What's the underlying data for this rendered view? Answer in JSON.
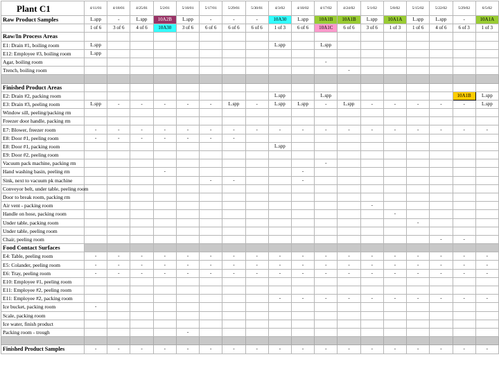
{
  "title": "Plant C1",
  "dates": [
    "4/11/01",
    "4/18/01",
    "4/25/01",
    "5/2/01",
    "5/10/01",
    "5/17/01",
    "5/29/01",
    "5/30/01",
    "4/3/02",
    "4/10/02",
    "4/17/02",
    "4/24/02",
    "5/1/02",
    "5/8/02",
    "5/15/02",
    "5/22/02",
    "5/29/02",
    "6/5/02"
  ],
  "colors": {
    "purple": "#993366",
    "cyan": "#33ffff",
    "green": "#99cc33",
    "pink": "#ff99cc",
    "orange": "#ffcc00",
    "gray": "#c8c8c8"
  },
  "rows": [
    {
      "type": "raw",
      "label": "Raw Product Samples",
      "cells": [
        {
          "v": "L.spp"
        },
        {
          "v": "-"
        },
        {
          "v": "L.spp"
        },
        {
          "v": "10A2B",
          "c": "purple"
        },
        {
          "v": "L.spp"
        },
        {
          "v": "-"
        },
        {
          "v": "-"
        },
        {
          "v": "-"
        },
        {
          "v": "10A30",
          "c": "cyan"
        },
        {
          "v": "L.spp"
        },
        {
          "v": "10A1B",
          "c": "green"
        },
        {
          "v": "10A1B",
          "c": "green"
        },
        {
          "v": "L.spp"
        },
        {
          "v": "10A1A",
          "c": "green"
        },
        {
          "v": "L.spp"
        },
        {
          "v": "L.spp"
        },
        {
          "v": "-"
        },
        {
          "v": "10A1A",
          "c": "green"
        }
      ]
    },
    {
      "type": "data",
      "label": "",
      "cells": [
        {
          "v": "1 of 6"
        },
        {
          "v": "3 of 6"
        },
        {
          "v": "4 of 6"
        },
        {
          "v": "10A30",
          "c": "cyan"
        },
        {
          "v": "3 of 6"
        },
        {
          "v": "6 of 6"
        },
        {
          "v": "6 of 6"
        },
        {
          "v": "6 of 6"
        },
        {
          "v": "1 of 3"
        },
        {
          "v": "6 of 6"
        },
        {
          "v": "10A1C",
          "c": "pink"
        },
        {
          "v": "6 of 6"
        },
        {
          "v": "3 of 6"
        },
        {
          "v": "1 of 3"
        },
        {
          "v": "1 of 6"
        },
        {
          "v": "4 of 6"
        },
        {
          "v": "6 of 3"
        },
        {
          "v": "1 of 3"
        }
      ]
    },
    {
      "type": "section",
      "label": "Raw/In Process Areas"
    },
    {
      "type": "data",
      "label": "E1:  Drain #1, boiling room",
      "cells": [
        {
          "v": "L.spp"
        },
        {},
        {},
        {},
        {},
        {},
        {},
        {},
        {
          "v": "L.spp"
        },
        {},
        {
          "v": "L.spp"
        },
        {},
        {},
        {},
        {},
        {},
        {},
        {}
      ]
    },
    {
      "type": "data",
      "label": "E12:  Employee #3, boiling room",
      "cells": [
        {
          "v": "L.spp"
        },
        {},
        {},
        {},
        {},
        {},
        {},
        {},
        {},
        {},
        {},
        {},
        {},
        {},
        {},
        {},
        {},
        {}
      ]
    },
    {
      "type": "data",
      "label": "Agar, boiling room",
      "cells": [
        {},
        {},
        {},
        {},
        {},
        {},
        {},
        {},
        {},
        {},
        {
          "v": "-"
        },
        {},
        {},
        {},
        {},
        {},
        {},
        {}
      ]
    },
    {
      "type": "data",
      "label": "Trench, boiling room",
      "cells": [
        {},
        {},
        {},
        {},
        {},
        {},
        {},
        {},
        {},
        {},
        {},
        {
          "v": "-"
        },
        {},
        {},
        {},
        {},
        {},
        {}
      ]
    },
    {
      "type": "gray",
      "label": ""
    },
    {
      "type": "section",
      "label": "Finished Product Areas"
    },
    {
      "type": "data",
      "label": "E2:  Drain #2, packing room",
      "cells": [
        {},
        {},
        {},
        {},
        {},
        {},
        {},
        {},
        {
          "v": "L.spp"
        },
        {},
        {
          "v": "L.spp"
        },
        {},
        {},
        {},
        {},
        {},
        {
          "v": "10A1B",
          "c": "orange"
        },
        {
          "v": "L.spp"
        }
      ]
    },
    {
      "type": "data",
      "label": "E3:  Drain #3, peeling room",
      "cells": [
        {
          "v": "L.spp"
        },
        {
          "v": "-"
        },
        {
          "v": "-"
        },
        {
          "v": "-"
        },
        {
          "v": "-"
        },
        {
          "v": "-"
        },
        {
          "v": "L.spp"
        },
        {
          "v": "-"
        },
        {
          "v": "L.spp"
        },
        {
          "v": "L.spp"
        },
        {
          "v": "-"
        },
        {
          "v": "L.spp"
        },
        {
          "v": "-"
        },
        {
          "v": "-"
        },
        {
          "v": "-"
        },
        {
          "v": "-"
        },
        {
          "v": "-"
        },
        {
          "v": "L.spp"
        }
      ]
    },
    {
      "type": "data",
      "label": "Window sill, peeling/packing rm",
      "cells": [
        {},
        {},
        {},
        {},
        {},
        {},
        {},
        {},
        {},
        {},
        {},
        {},
        {},
        {},
        {},
        {},
        {},
        {}
      ]
    },
    {
      "type": "data",
      "label": "Freezer door handle, packing rm",
      "cells": [
        {},
        {},
        {},
        {},
        {},
        {},
        {},
        {},
        {},
        {},
        {},
        {},
        {},
        {},
        {},
        {},
        {},
        {}
      ]
    },
    {
      "type": "data",
      "label": "E7:  Blower, freezer room",
      "cells": [
        {
          "v": "-"
        },
        {
          "v": "-"
        },
        {
          "v": "-"
        },
        {
          "v": "-"
        },
        {
          "v": "-"
        },
        {
          "v": "-"
        },
        {
          "v": "-"
        },
        {
          "v": "-"
        },
        {
          "v": "-"
        },
        {
          "v": "-"
        },
        {
          "v": "-"
        },
        {
          "v": "-"
        },
        {
          "v": "-"
        },
        {
          "v": "-"
        },
        {
          "v": "-"
        },
        {
          "v": "-"
        },
        {
          "v": "-"
        },
        {
          "v": "-"
        }
      ]
    },
    {
      "type": "data",
      "label": "E8:  Door #1, peeling room",
      "cells": [
        {
          "v": "-"
        },
        {
          "v": "-"
        },
        {
          "v": "-"
        },
        {
          "v": "-"
        },
        {
          "v": "-"
        },
        {
          "v": "-"
        },
        {
          "v": "-"
        },
        {},
        {},
        {},
        {},
        {},
        {},
        {},
        {},
        {},
        {},
        {}
      ]
    },
    {
      "type": "data",
      "label": "E8:  Door #1, packing room",
      "cells": [
        {},
        {},
        {},
        {},
        {},
        {},
        {},
        {},
        {
          "v": "L.spp"
        },
        {},
        {},
        {},
        {},
        {},
        {},
        {},
        {},
        {}
      ]
    },
    {
      "type": "data",
      "label": "E9:  Door #2, peeling room",
      "cells": [
        {},
        {},
        {},
        {},
        {},
        {},
        {},
        {},
        {},
        {},
        {},
        {},
        {},
        {},
        {},
        {},
        {},
        {}
      ]
    },
    {
      "type": "data",
      "label": "Vacuum pack machine, packing rm",
      "cells": [
        {},
        {},
        {},
        {},
        {},
        {},
        {},
        {},
        {},
        {},
        {
          "v": "-"
        },
        {},
        {},
        {},
        {},
        {},
        {},
        {}
      ]
    },
    {
      "type": "data",
      "label": "Hand washing basin, peeling rm",
      "cells": [
        {},
        {},
        {},
        {
          "v": "-"
        },
        {},
        {},
        {},
        {},
        {},
        {
          "v": "-"
        },
        {},
        {},
        {},
        {},
        {},
        {},
        {},
        {}
      ]
    },
    {
      "type": "data",
      "label": "Sink, next to vacuum pk machine",
      "cells": [
        {},
        {},
        {},
        {},
        {},
        {
          "v": "-"
        },
        {
          "v": "-"
        },
        {},
        {},
        {
          "v": "-"
        },
        {},
        {},
        {},
        {},
        {},
        {},
        {},
        {}
      ]
    },
    {
      "type": "data",
      "label": "Conveyor belt, under table, peeling room",
      "cells": [
        {},
        {},
        {},
        {},
        {},
        {},
        {},
        {},
        {},
        {},
        {},
        {},
        {},
        {},
        {},
        {},
        {},
        {}
      ]
    },
    {
      "type": "data",
      "label": "Door to break room, packing rm",
      "cells": [
        {},
        {},
        {},
        {},
        {},
        {},
        {},
        {},
        {},
        {},
        {},
        {},
        {},
        {},
        {},
        {},
        {},
        {}
      ]
    },
    {
      "type": "data",
      "label": "Air vent - packing room",
      "cells": [
        {},
        {},
        {},
        {},
        {},
        {},
        {},
        {},
        {},
        {},
        {},
        {},
        {
          "v": "-"
        },
        {},
        {},
        {},
        {},
        {}
      ]
    },
    {
      "type": "data",
      "label": "Handle on hose, packing room",
      "cells": [
        {},
        {},
        {},
        {},
        {},
        {},
        {},
        {},
        {},
        {},
        {},
        {},
        {},
        {
          "v": "-"
        },
        {},
        {},
        {},
        {}
      ]
    },
    {
      "type": "data",
      "label": "Under table, packing room",
      "cells": [
        {},
        {},
        {},
        {},
        {},
        {},
        {},
        {},
        {},
        {},
        {},
        {},
        {},
        {},
        {
          "v": "-"
        },
        {},
        {},
        {}
      ]
    },
    {
      "type": "data",
      "label": "Under table, peeling room",
      "cells": [
        {},
        {},
        {},
        {},
        {},
        {},
        {},
        {},
        {},
        {},
        {},
        {},
        {},
        {},
        {},
        {},
        {},
        {}
      ]
    },
    {
      "type": "data",
      "label": "Chair, peeling room",
      "cells": [
        {},
        {},
        {},
        {},
        {},
        {},
        {},
        {},
        {},
        {},
        {},
        {},
        {},
        {},
        {},
        {
          "v": "-"
        },
        {
          "v": "-"
        },
        {}
      ]
    },
    {
      "type": "section",
      "label": "Food Contact Surfaces",
      "gray_cells": true
    },
    {
      "type": "data",
      "label": "E4:  Table, peeling room",
      "cells": [
        {
          "v": "-"
        },
        {
          "v": "-"
        },
        {
          "v": "-"
        },
        {
          "v": "-"
        },
        {
          "v": "-"
        },
        {
          "v": "-"
        },
        {
          "v": "-"
        },
        {
          "v": "-"
        },
        {
          "v": "-"
        },
        {
          "v": "-"
        },
        {
          "v": "-"
        },
        {
          "v": "-"
        },
        {
          "v": "-"
        },
        {
          "v": "-"
        },
        {
          "v": "-"
        },
        {
          "v": "-"
        },
        {
          "v": "-"
        },
        {
          "v": "-"
        }
      ]
    },
    {
      "type": "data",
      "label": "E5:  Colander, peeling room",
      "cells": [
        {
          "v": "-"
        },
        {
          "v": "-"
        },
        {
          "v": "-"
        },
        {
          "v": "-"
        },
        {
          "v": "-"
        },
        {
          "v": "-"
        },
        {
          "v": "-"
        },
        {
          "v": "-"
        },
        {
          "v": "-"
        },
        {
          "v": "-"
        },
        {
          "v": "-"
        },
        {
          "v": "-"
        },
        {
          "v": "-"
        },
        {
          "v": "-"
        },
        {
          "v": "-"
        },
        {
          "v": "-"
        },
        {
          "v": "-"
        },
        {
          "v": "-"
        }
      ]
    },
    {
      "type": "data",
      "label": "E6:  Tray, peeling room",
      "cells": [
        {
          "v": "-"
        },
        {
          "v": "-"
        },
        {
          "v": "-"
        },
        {
          "v": "-"
        },
        {
          "v": "-"
        },
        {
          "v": "-"
        },
        {
          "v": "-"
        },
        {
          "v": "-"
        },
        {
          "v": "-"
        },
        {
          "v": "-"
        },
        {
          "v": "-"
        },
        {
          "v": "-"
        },
        {
          "v": "-"
        },
        {
          "v": "-"
        },
        {
          "v": "-"
        },
        {
          "v": "-"
        },
        {
          "v": "-"
        },
        {
          "v": "-"
        }
      ]
    },
    {
      "type": "data",
      "label": "E10:  Employee #1, peeling room",
      "cells": [
        {},
        {},
        {},
        {},
        {},
        {},
        {},
        {},
        {},
        {},
        {},
        {},
        {},
        {},
        {},
        {},
        {},
        {}
      ]
    },
    {
      "type": "data",
      "label": "E11:  Employee #2, peeling room",
      "cells": [
        {},
        {},
        {},
        {},
        {},
        {},
        {},
        {},
        {},
        {},
        {},
        {},
        {},
        {},
        {},
        {},
        {},
        {}
      ]
    },
    {
      "type": "data",
      "label": "E11: Employee #2, packing room",
      "cells": [
        {},
        {},
        {},
        {},
        {},
        {},
        {},
        {},
        {
          "v": "-"
        },
        {
          "v": "-"
        },
        {
          "v": "-"
        },
        {
          "v": "-"
        },
        {
          "v": "-"
        },
        {
          "v": "-"
        },
        {
          "v": "-"
        },
        {
          "v": "-"
        },
        {
          "v": "-"
        },
        {
          "v": "-"
        }
      ]
    },
    {
      "type": "data",
      "label": "Ice bucket, packing room",
      "cells": [
        {
          "v": "-"
        },
        {},
        {},
        {},
        {},
        {},
        {},
        {},
        {},
        {},
        {},
        {},
        {},
        {},
        {},
        {},
        {},
        {}
      ]
    },
    {
      "type": "data",
      "label": "Scale, packing room",
      "cells": [
        {},
        {},
        {},
        {},
        {},
        {},
        {},
        {},
        {},
        {},
        {},
        {},
        {},
        {},
        {},
        {},
        {},
        {}
      ]
    },
    {
      "type": "data",
      "label": "Ice water, finish product",
      "cells": [
        {},
        {},
        {},
        {},
        {},
        {},
        {},
        {},
        {},
        {},
        {},
        {},
        {},
        {},
        {},
        {},
        {},
        {}
      ]
    },
    {
      "type": "data",
      "label": "Packing room - trough",
      "cells": [
        {},
        {},
        {},
        {},
        {
          "v": "-"
        },
        {},
        {},
        {},
        {},
        {},
        {},
        {},
        {},
        {},
        {},
        {},
        {},
        {}
      ]
    },
    {
      "type": "gray",
      "label": ""
    },
    {
      "type": "fps",
      "label": "Finished Product Samples",
      "cells": [
        {
          "v": "-"
        },
        {
          "v": "-"
        },
        {
          "v": "-"
        },
        {
          "v": "-"
        },
        {
          "v": "-"
        },
        {
          "v": "-"
        },
        {
          "v": "-"
        },
        {
          "v": "-"
        },
        {
          "v": "-"
        },
        {
          "v": "-"
        },
        {
          "v": "-"
        },
        {
          "v": "-"
        },
        {
          "v": "-"
        },
        {
          "v": "-"
        },
        {
          "v": "-"
        },
        {
          "v": "-"
        },
        {
          "v": "-"
        },
        {
          "v": "-"
        }
      ]
    }
  ]
}
